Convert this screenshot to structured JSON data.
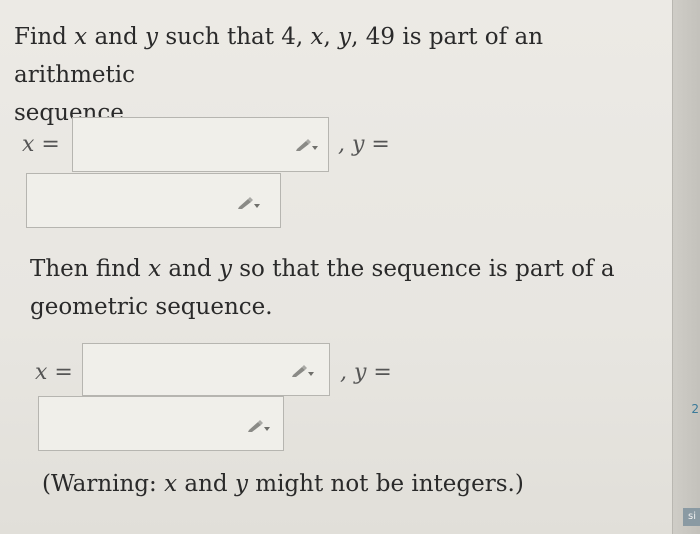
{
  "problem": {
    "part1_line1_a": "Find ",
    "var_x": "x",
    "part1_line1_b": " and ",
    "var_y": "y",
    "part1_line1_c": " such that 4, ",
    "part1_line1_d": ", ",
    "part1_line1_e": ", 49 is part of an arithmetic",
    "part1_line2": "sequence.",
    "part2_line1_a": "Then find ",
    "part2_line1_b": " and ",
    "part2_line1_c": " so that the sequence is part of a",
    "part2_line2": "geometric sequence.",
    "warning_a": "(Warning: ",
    "warning_b": " and ",
    "warning_c": " might not be integers.)"
  },
  "arithmetic": {
    "x_label": "x =",
    "y_label": ", y =",
    "x_value": "",
    "y_value": ""
  },
  "geometric": {
    "x_label": "x =",
    "y_label": ", y =",
    "x_value": "",
    "y_value": ""
  },
  "edge": {
    "mark_top": "2",
    "mark_bottom": "si"
  },
  "icons": {
    "pencil": "pencil-dropdown-icon"
  }
}
